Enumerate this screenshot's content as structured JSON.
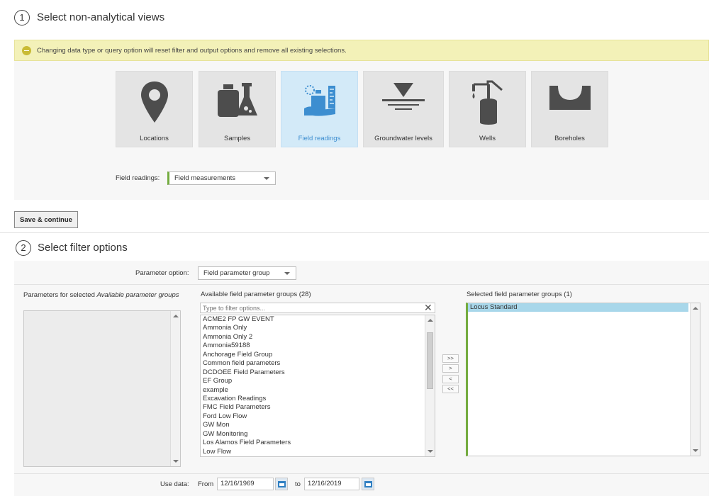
{
  "step1": {
    "number": "1",
    "title": "Select non-analytical views"
  },
  "warning": {
    "text": "Changing data type or query option will reset filter and output options and remove all existing selections."
  },
  "tiles": [
    {
      "label": "Locations",
      "icon": "location-pin-icon"
    },
    {
      "label": "Samples",
      "icon": "samples-icon"
    },
    {
      "label": "Field readings",
      "icon": "field-readings-icon",
      "active": true
    },
    {
      "label": "Groundwater levels",
      "icon": "groundwater-icon"
    },
    {
      "label": "Wells",
      "icon": "well-icon"
    },
    {
      "label": "Boreholes",
      "icon": "borehole-icon"
    }
  ],
  "field_readings": {
    "label": "Field readings:",
    "value": "Field measurements"
  },
  "save_button": "Save & continue",
  "step2": {
    "number": "2",
    "title": "Select filter options"
  },
  "parameter_option": {
    "label": "Parameter option:",
    "value": "Field parameter group"
  },
  "left_panel": {
    "title_prefix": "Parameters for selected ",
    "title_em": "Available parameter groups"
  },
  "available": {
    "header": "Available field parameter groups (28)",
    "filter_placeholder": "Type to filter options...",
    "items": [
      "ACME2 FP GW EVENT",
      "Ammonia Only",
      "Ammonia Only 2",
      "Ammonia59188",
      "Anchorage Field Group",
      "Common field parameters",
      "DCDOEE Field Parameters",
      "EF Group",
      "example",
      "Excavation Readings",
      "FMC Field Parameters",
      "Ford Low Flow",
      "GW Mon",
      "GW Monitoring",
      "Los Alamos Field Parameters",
      "Low Flow"
    ]
  },
  "move_buttons": [
    ">>",
    ">",
    "<",
    "<<"
  ],
  "selected": {
    "header": "Selected field parameter groups (1)",
    "items": [
      "Locus Standard"
    ]
  },
  "use_data": {
    "label": "Use data:",
    "from_label": "From",
    "from": "12/16/1969",
    "to_label": "to",
    "to": "12/16/2019"
  },
  "colors": {
    "accent_blue": "#3d8ed0",
    "green_border": "#74ac3f",
    "warning_bg": "#f3f1b8",
    "selected_row": "#a8d7ea"
  }
}
